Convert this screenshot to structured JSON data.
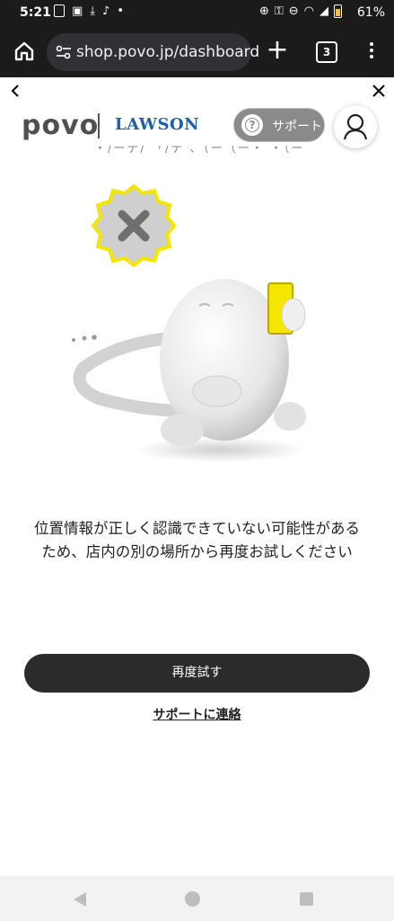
{
  "status_bar": {
    "time": "5:21",
    "battery": "61%"
  },
  "browser": {
    "url": "shop.povo.jp/dashboard",
    "tab_count": "3"
  },
  "header": {
    "brand": "povo",
    "partner": "LAWSON",
    "support_label": "サポート",
    "help_glyph": "?"
  },
  "main": {
    "partial_text": "・/ーデ/ 「/テ 、（ー（ー・ ・（ー（ー（ー",
    "message_line1": "位置情報が正しく認識できていない可能性がある",
    "message_line2": "ため、店内の別の場所から再度お試しください",
    "retry_label": "再度試す",
    "support_link": "サポートに連絡"
  },
  "colors": {
    "accent": "#f5e600",
    "button": "#2b2b2b",
    "partner_blue": "#1f5fa6"
  }
}
